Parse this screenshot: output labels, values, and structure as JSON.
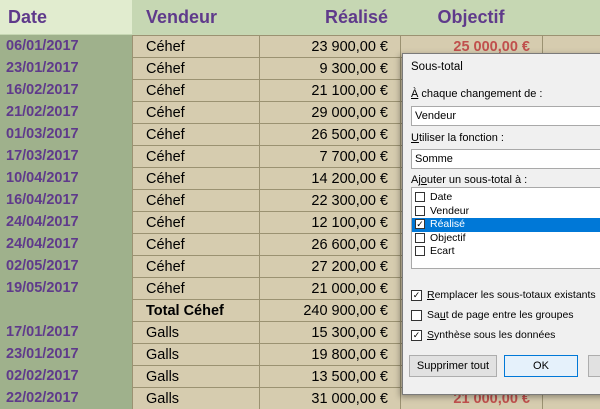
{
  "headers": {
    "date": "Date",
    "vendeur": "Vendeur",
    "realise": "Réalisé",
    "objectif": "Objectif"
  },
  "rows": [
    {
      "date": "06/01/2017",
      "vendeur": "Céhef",
      "realise": "23 900,00 €",
      "objectif": "25 000,00 €"
    },
    {
      "date": "23/01/2017",
      "vendeur": "Céhef",
      "realise": "9 300,00 €",
      "objectif": ""
    },
    {
      "date": "16/02/2017",
      "vendeur": "Céhef",
      "realise": "21 100,00 €",
      "objectif": ""
    },
    {
      "date": "21/02/2017",
      "vendeur": "Céhef",
      "realise": "29 000,00 €",
      "objectif": ""
    },
    {
      "date": "01/03/2017",
      "vendeur": "Céhef",
      "realise": "26 500,00 €",
      "objectif": ""
    },
    {
      "date": "17/03/2017",
      "vendeur": "Céhef",
      "realise": "7 700,00 €",
      "objectif": ""
    },
    {
      "date": "10/04/2017",
      "vendeur": "Céhef",
      "realise": "14 200,00 €",
      "objectif": ""
    },
    {
      "date": "16/04/2017",
      "vendeur": "Céhef",
      "realise": "22 300,00 €",
      "objectif": ""
    },
    {
      "date": "24/04/2017",
      "vendeur": "Céhef",
      "realise": "12 100,00 €",
      "objectif": ""
    },
    {
      "date": "24/04/2017",
      "vendeur": "Céhef",
      "realise": "26 600,00 €",
      "objectif": ""
    },
    {
      "date": "02/05/2017",
      "vendeur": "Céhef",
      "realise": "27 200,00 €",
      "objectif": ""
    },
    {
      "date": "19/05/2017",
      "vendeur": "Céhef",
      "realise": "21 000,00 €",
      "objectif": ""
    },
    {
      "date": "",
      "vendeur": "Total Céhef",
      "realise": "240 900,00 €",
      "objectif": "",
      "total": true
    },
    {
      "date": "17/01/2017",
      "vendeur": "Galls",
      "realise": "15 300,00 €",
      "objectif": ""
    },
    {
      "date": "23/01/2017",
      "vendeur": "Galls",
      "realise": "19 800,00 €",
      "objectif": ""
    },
    {
      "date": "02/02/2017",
      "vendeur": "Galls",
      "realise": "13 500,00 €",
      "objectif": ""
    },
    {
      "date": "22/02/2017",
      "vendeur": "Galls",
      "realise": "31 000,00 €",
      "objectif": "21 000,00 €"
    }
  ],
  "dialog": {
    "title": "Sous-total",
    "change_label_u": "À",
    "change_label_rest": " chaque changement de :",
    "change_value": "Vendeur",
    "function_label_u": "U",
    "function_label_rest": "tiliser la fonction :",
    "function_value": "Somme",
    "add_label_pre": "Aj",
    "add_label_u": "o",
    "add_label_rest": "uter un sous-total à :",
    "fields": [
      {
        "label": "Date",
        "checked": false,
        "selected": false
      },
      {
        "label": "Vendeur",
        "checked": false,
        "selected": false
      },
      {
        "label": "Réalisé",
        "checked": true,
        "selected": true
      },
      {
        "label": "Objectif",
        "checked": false,
        "selected": false
      },
      {
        "label": "Ecart",
        "checked": false,
        "selected": false
      }
    ],
    "options": [
      {
        "u": "R",
        "rest": "emplacer les sous-totaux existants",
        "checked": true
      },
      {
        "pre": "Sa",
        "u": "u",
        "rest": "t de page entre les groupes",
        "checked": false
      },
      {
        "u": "S",
        "rest": "ynthèse sous les données",
        "checked": true
      }
    ],
    "btn_remove": "Supprimer tout",
    "btn_ok": "OK",
    "checkmark": "✓"
  }
}
